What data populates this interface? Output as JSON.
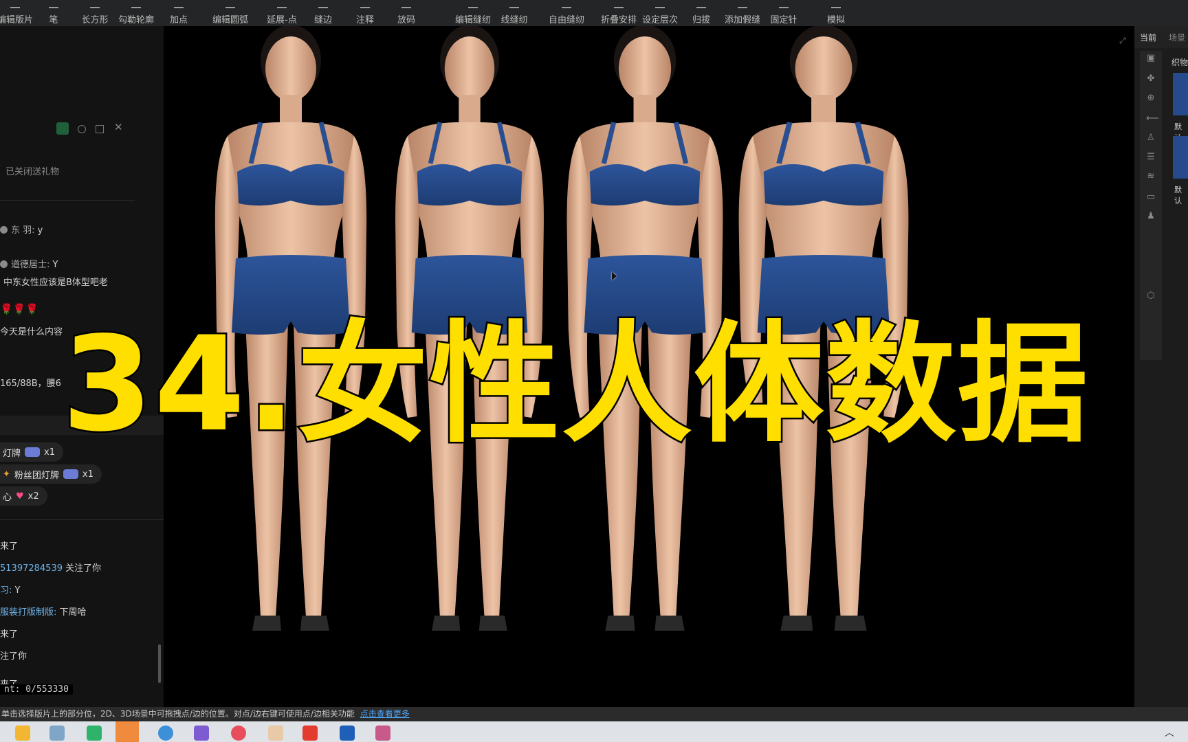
{
  "toolbar": {
    "items": [
      "编辑版片",
      "笔",
      "长方形",
      "勾勒轮廓",
      "加点",
      "编辑圆弧",
      "延展-点",
      "缝边",
      "注释",
      "放码",
      "编辑缝纫",
      "线缝纫",
      "自由缝纫",
      "折叠安排",
      "设定层次",
      "归拔",
      "添加假缝",
      "固定针",
      "模拟"
    ]
  },
  "chat": {
    "gift_closed": "已关闭送礼物",
    "messages": [
      {
        "user": "东 羽:",
        "text": "y"
      },
      {
        "user": "道德居士:",
        "text": "Y"
      },
      {
        "user": "",
        "text": "中东女性应该是B体型吧老"
      },
      {
        "user": "",
        "text": "🌹🌹🌹"
      },
      {
        "user": "",
        "text": "今天是什么内容"
      },
      {
        "user": "",
        "text": "165/88B，腰6"
      }
    ],
    "gifts": [
      {
        "name": "灯牌",
        "count": "x1"
      },
      {
        "name": "粉丝团灯牌",
        "count": "x1"
      },
      {
        "name": "心",
        "count": "x2"
      }
    ],
    "feed": [
      {
        "user": "",
        "text": "来了"
      },
      {
        "user": "51397284539",
        "text": "关注了你"
      },
      {
        "user": "习:",
        "text": "Y"
      },
      {
        "user": "服装打版制版:",
        "text": "下周哈"
      },
      {
        "user": "",
        "text": "来了"
      },
      {
        "user": "",
        "text": "注了你"
      },
      {
        "user": "",
        "text": "来了"
      }
    ],
    "count": "nt: 0/553330"
  },
  "viewport": {
    "title": "34.女性人体数据",
    "figures": 4
  },
  "right_panel": {
    "tab_current": "当前",
    "tab_scene": "场景",
    "fabric_label": "织物",
    "swatch_label": "默认"
  },
  "status": {
    "text": "单击选择版片上的部分位，2D、3D场景中可拖拽点/边的位置。对点/边右键可使用点/边相关功能",
    "link": "点击查看更多"
  },
  "colors": {
    "title_yellow": "#ffdf00",
    "fabric_blue": "#264a8c",
    "skin": "#e3b596"
  }
}
